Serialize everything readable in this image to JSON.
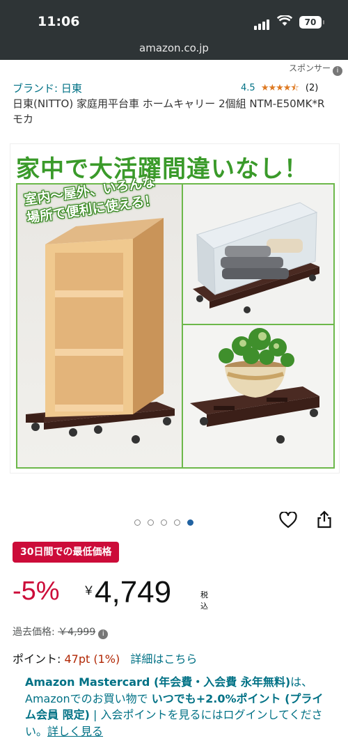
{
  "status_bar": {
    "time": "11:06",
    "battery": "70"
  },
  "browser": {
    "url": "amazon.co.jp"
  },
  "sponsored": {
    "label": "スポンサー"
  },
  "product": {
    "brand_label": "ブランド: 日東",
    "rating_value": "4.5",
    "rating_stars": 4.5,
    "rating_count": "(2)",
    "title": "日東(NITTO) 家庭用平台車 ホームキャリー 2個組 NTM-E50MK*R モカ"
  },
  "image": {
    "banner": "家中で大活躍間違いなし！",
    "caption_line1": "室内～屋外、いろんな",
    "caption_line2": "場所で便利に使える！",
    "carousel_total": 5,
    "carousel_active": 5
  },
  "deal_badge": "30日間での最低価格",
  "price": {
    "discount": "-5%",
    "currency": "￥",
    "amount": "4,749",
    "tax_note": "税込"
  },
  "past_price": {
    "label": "過去価格:",
    "value": "￥4,999"
  },
  "points": {
    "label": "ポイント: ",
    "value": "47pt",
    "percent": "(1%)",
    "link": "詳細はこちら"
  },
  "mastercard": {
    "part1": "Amazon Mastercard (年会費・入会費 永年無料)",
    "part2": "は、Amazonでのお買い物で ",
    "part3": "いつでも+2.0%ポイント (プライム会員 限定)",
    "part4": " | 入会ポイントを見るにはログインしてください。",
    "link": "詳しく見る"
  },
  "colors": {
    "accent_link": "#007185",
    "deal_red": "#cc0c39",
    "star_orange": "#de7921",
    "banner_green": "#3a9a2a"
  }
}
